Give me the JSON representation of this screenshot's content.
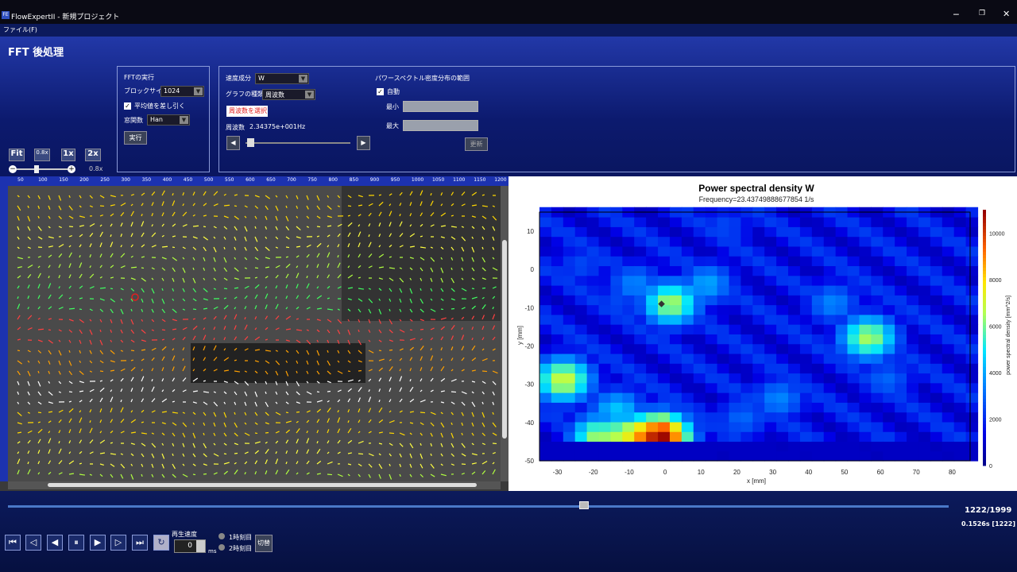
{
  "window": {
    "title": "FlowExpertII - 新規プロジェクト",
    "app_icon": "FE"
  },
  "menu": {
    "file": "ファイル(F)"
  },
  "page_title": "FFT 後処理",
  "zoom": {
    "fit": "Fit",
    "z08": "0.8x",
    "z1": "1x",
    "z2": "2x",
    "value": "0.8x"
  },
  "fft_group": {
    "title": "FFTの実行",
    "block_size_label": "ブロックサイズ",
    "block_size_value": "1024",
    "subtract_mean": "平均値を差し引く",
    "window_label": "窓関数",
    "window_value": "Han",
    "run": "実行"
  },
  "settings": {
    "velocity_label": "速度成分",
    "velocity_value": "W",
    "graph_type_label": "グラフの種類",
    "graph_type_value": "周波数",
    "select_freq": "周波数を選択",
    "freq_label": "周波数",
    "freq_value": "2.34375e+001Hz",
    "psd_range_title": "パワースペクトル密度分布の範囲",
    "auto": "自動",
    "min_label": "最小",
    "max_label": "最大",
    "update": "更新"
  },
  "ruler": [
    "50",
    "100",
    "150",
    "200",
    "250",
    "300",
    "350",
    "400",
    "450",
    "500",
    "550",
    "600",
    "650",
    "700",
    "750",
    "800",
    "850",
    "900",
    "950",
    "1000",
    "1050",
    "1100",
    "1150",
    "1200"
  ],
  "chart_data": {
    "type": "heatmap",
    "title": "Power spectral density W",
    "subtitle": "Frequency=23.43749888677854 1/s",
    "xlabel": "x [mm]",
    "ylabel": "y [mm]",
    "colorbar_label": "power spectral density [mm^2/s]",
    "xlim": [
      -35,
      85
    ],
    "ylim": [
      -50,
      15
    ],
    "xticks": [
      -30,
      -20,
      -10,
      0,
      10,
      20,
      30,
      40,
      50,
      60,
      70,
      80
    ],
    "yticks": [
      10,
      0,
      -10,
      -20,
      -30,
      -40,
      -50
    ],
    "cbar_ticks": [
      0,
      2000,
      4000,
      6000,
      8000,
      10000
    ],
    "zlim": [
      0,
      11000
    ],
    "hotspots": [
      {
        "x": -30,
        "y": -30,
        "value": 7000
      },
      {
        "x": 0,
        "y": -10,
        "value": 6500
      },
      {
        "x": 55,
        "y": -19,
        "value": 6500
      },
      {
        "x": -15,
        "y": -38,
        "value": 4500
      },
      {
        "x": -8,
        "y": -45,
        "value": 9000
      },
      {
        "x": -3,
        "y": -45,
        "value": 11000
      },
      {
        "x": -12,
        "y": -45,
        "value": 7500
      },
      {
        "x": -20,
        "y": -45,
        "value": 6500
      },
      {
        "x": -10,
        "y": -5,
        "value": 3500
      },
      {
        "x": 10,
        "y": -5,
        "value": 4000
      },
      {
        "x": 30,
        "y": -35,
        "value": 3500
      },
      {
        "x": 20,
        "y": -40,
        "value": 3000
      },
      {
        "x": 45,
        "y": -10,
        "value": 3500
      },
      {
        "x": -15,
        "y": -10,
        "value": 2500
      },
      {
        "x": 60,
        "y": -30,
        "value": 3000
      },
      {
        "x": 15,
        "y": 10,
        "value": 2500
      },
      {
        "x": -25,
        "y": 0,
        "value": 2500
      }
    ],
    "marker": {
      "x": -1,
      "y": -9
    }
  },
  "playback": {
    "frame": "1222/1999",
    "time": "0.1526s [1222]",
    "speed_label": "再生速度",
    "speed_value": "0",
    "speed_unit": "ms",
    "opt1": "1時刻目",
    "opt2": "2時刻目",
    "switch": "切替",
    "progress": 0.612
  }
}
